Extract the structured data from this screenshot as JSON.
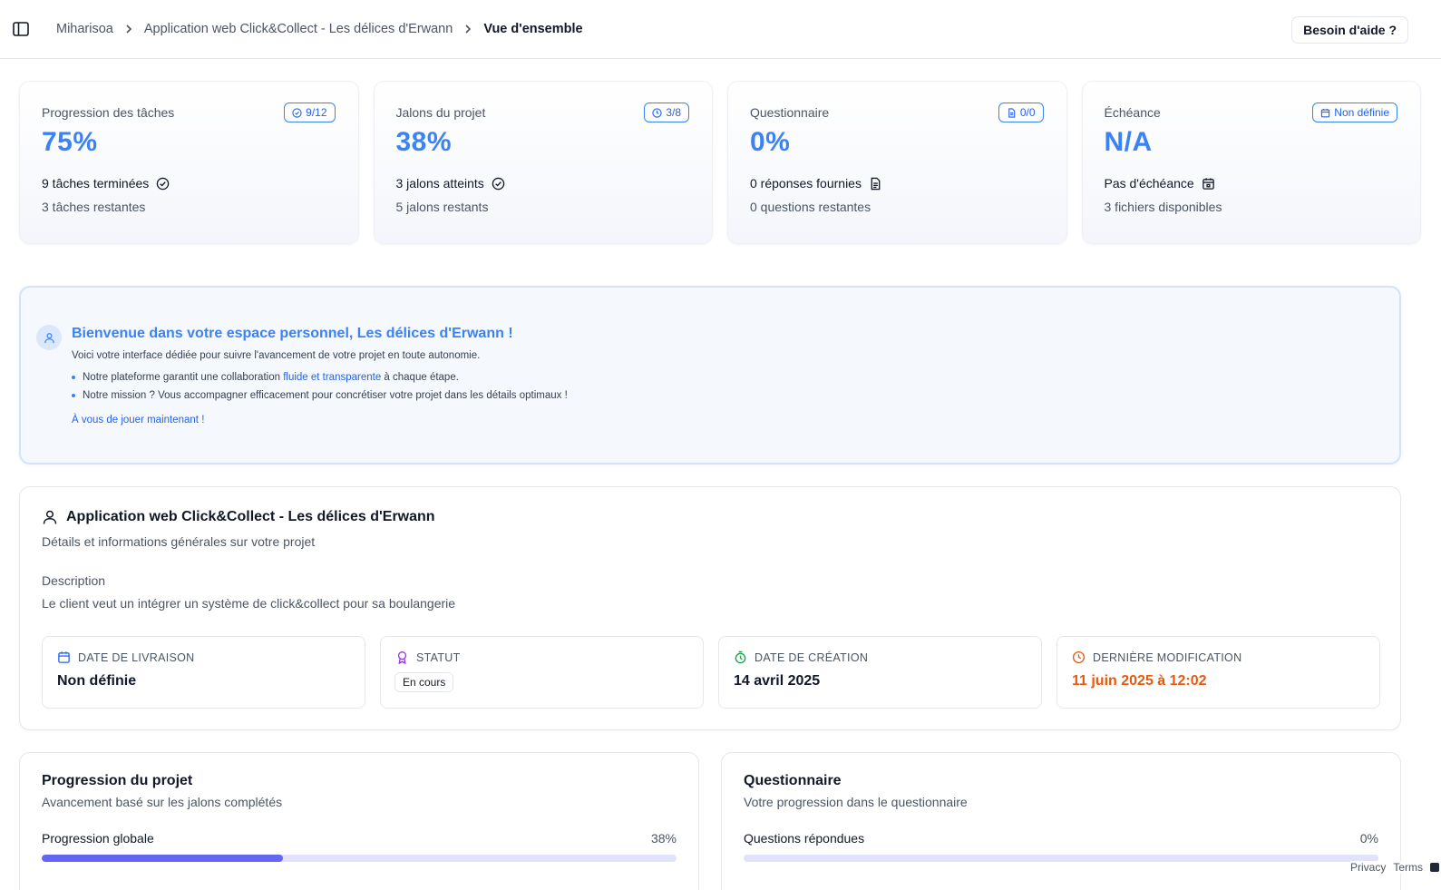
{
  "header": {
    "breadcrumb": [
      "Miharisoa",
      "Application web Click&Collect - Les délices d'Erwann",
      "Vue d'ensemble"
    ],
    "help_label": "Besoin d'aide ?"
  },
  "stats": [
    {
      "title": "Progression des tâches",
      "badge": "9/12",
      "badge_icon": "clock-check-icon",
      "value": "75%",
      "line1": "9 tâches terminées",
      "line1_icon": "check-circle-icon",
      "line2": "3 tâches restantes"
    },
    {
      "title": "Jalons du projet",
      "badge": "3/8",
      "badge_icon": "clock-icon",
      "value": "38%",
      "line1": "3 jalons atteints",
      "line1_icon": "check-circle-icon",
      "line2": "5 jalons restants"
    },
    {
      "title": "Questionnaire",
      "badge": "0/0",
      "badge_icon": "document-icon",
      "value": "0%",
      "line1": "0 réponses fournies",
      "line1_icon": "document-icon",
      "line2": "0 questions restantes"
    },
    {
      "title": "Échéance",
      "badge": "Non définie",
      "badge_icon": "calendar-icon",
      "value": "N/A",
      "line1": "Pas d'échéance",
      "line1_icon": "calendar-icon",
      "line2": "3 fichiers disponibles"
    }
  ],
  "welcome": {
    "title": "Bienvenue dans votre espace personnel, Les délices d'Erwann !",
    "subtitle": "Voici votre interface dédiée pour suivre l'avancement de votre projet en toute autonomie.",
    "bullet1_pre": "Notre plateforme garantit une collaboration ",
    "bullet1_hl": "fluide et transparente",
    "bullet1_post": " à chaque étape.",
    "bullet2": "Notre mission ? Vous accompagner efficacement pour concrétiser votre projet dans les détails optimaux !",
    "cta": "À vous de jouer maintenant !"
  },
  "project": {
    "title": "Application web Click&Collect - Les délices d'Erwann",
    "subtitle": "Détails et informations générales sur votre projet",
    "description_label": "Description",
    "description": "Le client veut un intégrer un système de click&collect pour sa boulangerie",
    "delivery_label": "DATE DE LIVRAISON",
    "delivery_value": "Non définie",
    "status_label": "STATUT",
    "status_value": "En cours",
    "created_label": "DATE DE CRÉATION",
    "created_value": "14 avril 2025",
    "modified_label": "DERNIÈRE MODIFICATION",
    "modified_value": "11 juin 2025 à 12:02",
    "colors": {
      "delivery": "#2563eb",
      "status": "#9333ea",
      "created": "#16a34a",
      "modified": "#ea580c"
    }
  },
  "progress": {
    "title": "Progression du projet",
    "subtitle": "Avancement basé sur les jalons complétés",
    "label": "Progression globale",
    "value_text": "38%",
    "value": 0.38
  },
  "questionnaire": {
    "title": "Questionnaire",
    "subtitle": "Votre progression dans le questionnaire",
    "label": "Questions répondues",
    "value_text": "0%",
    "value": 0
  },
  "footer": {
    "privacy": "Privacy",
    "terms": "Terms"
  },
  "accent_color": "#3b82f6"
}
